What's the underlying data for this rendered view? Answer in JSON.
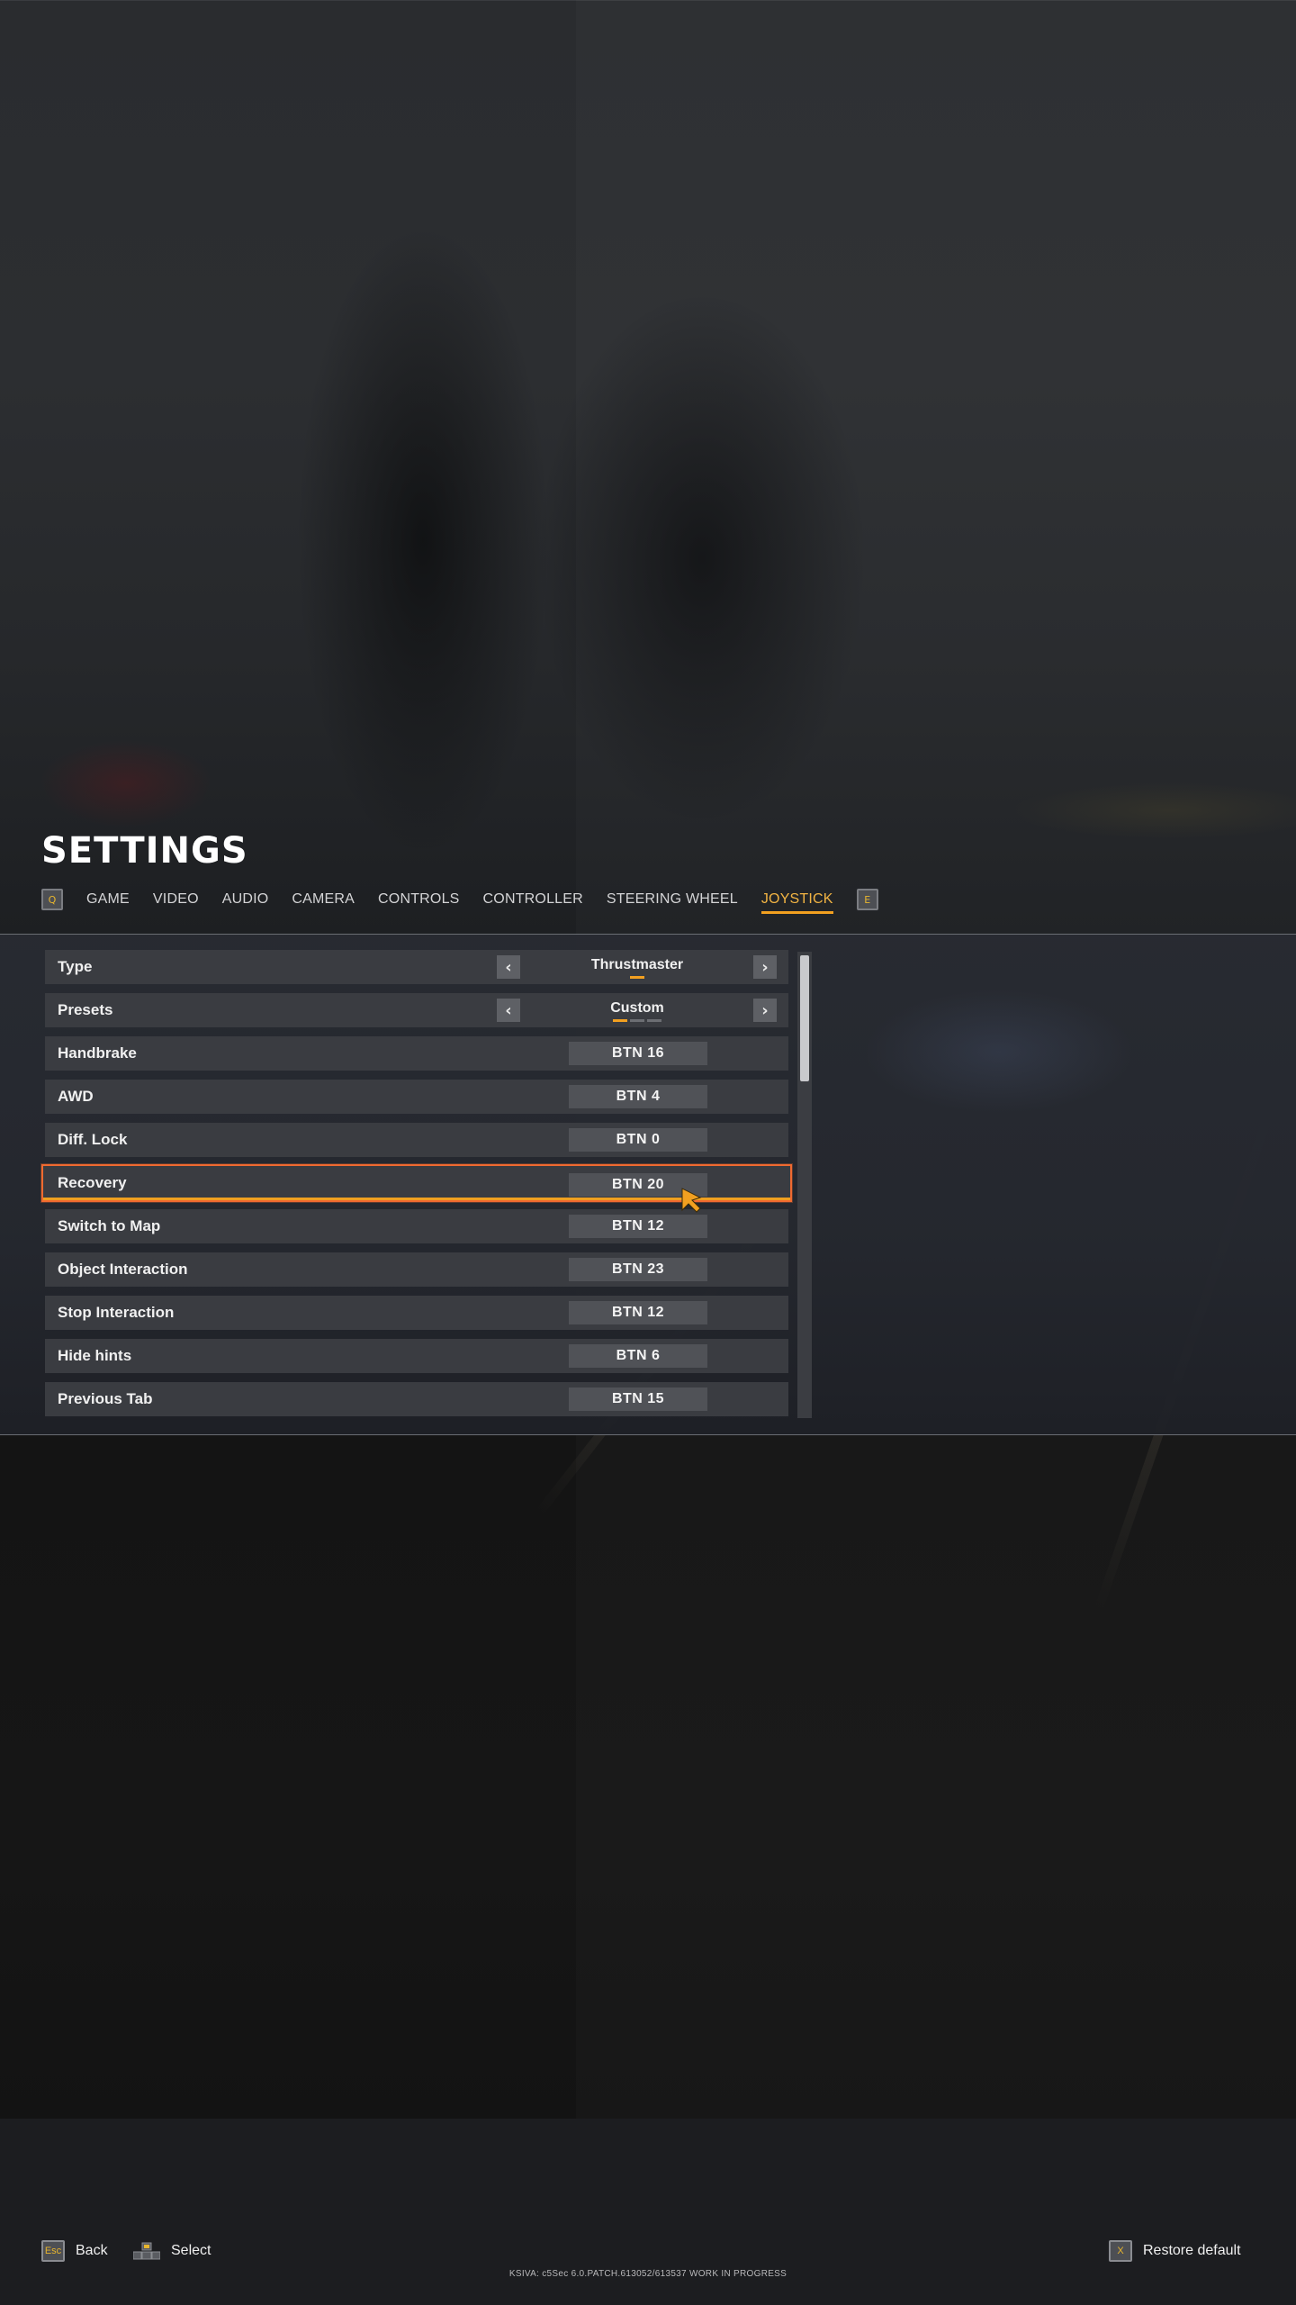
{
  "page_title": "SETTINGS",
  "tabs": {
    "prev_key": "Q",
    "next_key": "E",
    "items": [
      {
        "label": "GAME",
        "active": false
      },
      {
        "label": "VIDEO",
        "active": false
      },
      {
        "label": "AUDIO",
        "active": false
      },
      {
        "label": "CAMERA",
        "active": false
      },
      {
        "label": "CONTROLS",
        "active": false
      },
      {
        "label": "CONTROLLER",
        "active": false
      },
      {
        "label": "STEERING WHEEL",
        "active": false
      },
      {
        "label": "JOYSTICK",
        "active": true
      }
    ]
  },
  "settings": {
    "selectors": [
      {
        "label": "Type",
        "value": "Thrustmaster",
        "option_count": 1,
        "selected_index": 0
      },
      {
        "label": "Presets",
        "value": "Custom",
        "option_count": 3,
        "selected_index": 0
      }
    ],
    "bindings": [
      {
        "label": "Handbrake",
        "value": "BTN 16",
        "selected": false
      },
      {
        "label": "AWD",
        "value": "BTN 4",
        "selected": false
      },
      {
        "label": "Diff. Lock",
        "value": "BTN 0",
        "selected": false
      },
      {
        "label": "Recovery",
        "value": "BTN 20",
        "selected": true
      },
      {
        "label": "Switch to Map",
        "value": "BTN 12",
        "selected": false
      },
      {
        "label": "Object Interaction",
        "value": "BTN 23",
        "selected": false
      },
      {
        "label": "Stop Interaction",
        "value": "BTN 12",
        "selected": false
      },
      {
        "label": "Hide hints",
        "value": "BTN 6",
        "selected": false
      },
      {
        "label": "Previous Tab",
        "value": "BTN 15",
        "selected": false
      }
    ]
  },
  "footer": {
    "back_key": "Esc",
    "back_label": "Back",
    "select_label": "Select",
    "restore_key": "X",
    "restore_label": "Restore default",
    "build_info": "KSIVA: c5Sec   6.0.PATCH.613052/613537   WORK IN PROGRESS"
  },
  "colors": {
    "accent": "#f2a020",
    "selection_border": "#f06a30",
    "keycap_glyph": "#e7b52e"
  }
}
